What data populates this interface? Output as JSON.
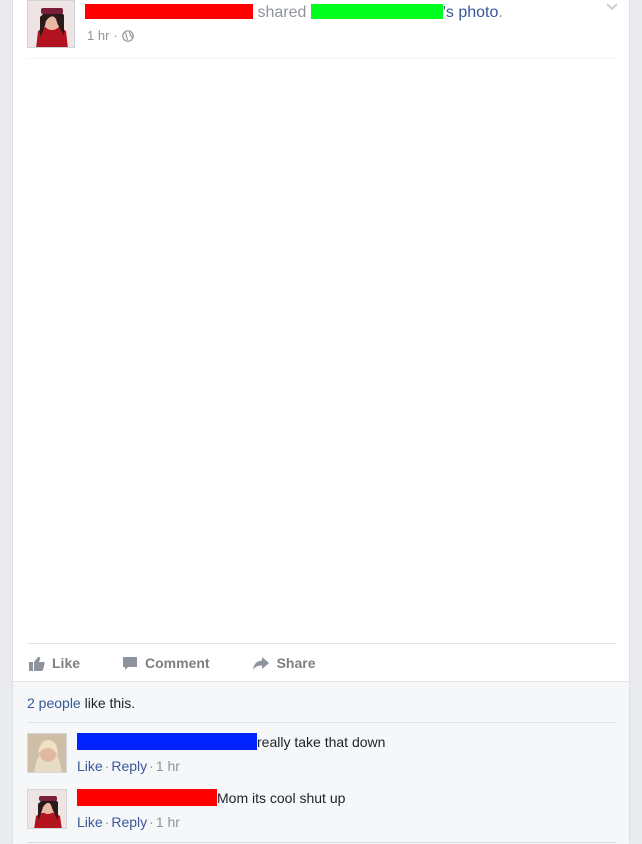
{
  "post": {
    "shared_word": "shared",
    "photo_suffix": "'s photo",
    "period": ".",
    "time": "1 hr",
    "separator": "·"
  },
  "actions": {
    "like": "Like",
    "comment": "Comment",
    "share": "Share"
  },
  "likes": {
    "count_link": "2 people",
    "suffix": "like this."
  },
  "comments": [
    {
      "text": "really take that down",
      "like": "Like",
      "reply": "Reply",
      "time": "1 hr"
    },
    {
      "text": "Mom its cool shut up",
      "like": "Like",
      "reply": "Reply",
      "time": "1 hr"
    }
  ],
  "colors": {
    "redaction_red": "#ff0000",
    "redaction_green": "#00ff1e",
    "redaction_blue": "#0022ff",
    "link": "#365899"
  }
}
